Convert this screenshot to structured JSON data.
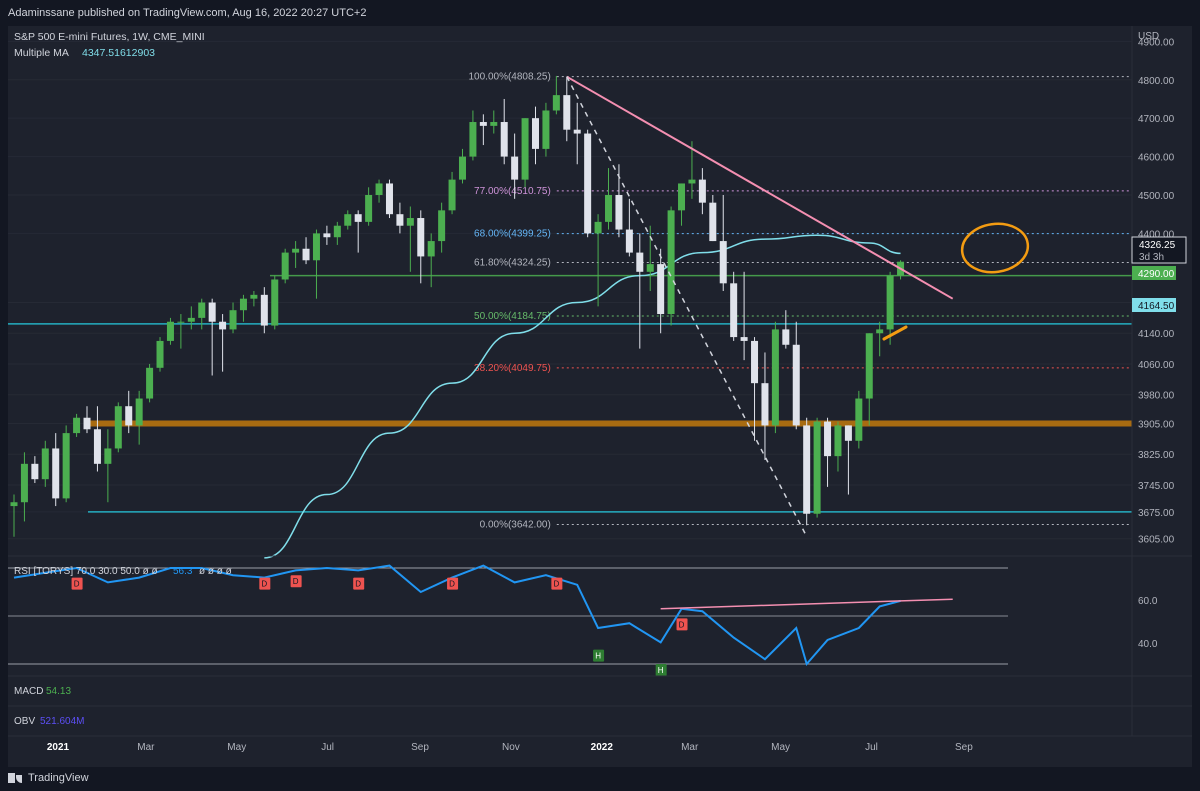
{
  "header": {
    "published_text": "Adaminssane published on TradingView.com, Aug 16, 2022 20:27 UTC+2"
  },
  "legend": {
    "symbol_line": "S&P 500 E-mini Futures, 1W, CME_MINI",
    "ma_label": "Multiple MA",
    "ma_value": "4347.51612903"
  },
  "price_axis": {
    "currency": "USD",
    "ticks": [
      "4900.00",
      "4800.00",
      "4700.00",
      "4600.00",
      "4500.00",
      "4400.00",
      "4220.00",
      "4140.00",
      "4060.00",
      "3980.00",
      "3905.00",
      "3825.00",
      "3745.00",
      "3675.00",
      "3605.00"
    ],
    "current_price": "4326.25",
    "countdown": "3d 3h",
    "green_tag": "4290.00",
    "cyan_tag": "4164.50"
  },
  "fib_labels": [
    {
      "text": "100.00%(4808.25)",
      "color": "#b2b5be"
    },
    {
      "text": "77.00%(4510.75)",
      "color": "#ce93d8"
    },
    {
      "text": "68.00%(4399.25)",
      "color": "#64b5f6"
    },
    {
      "text": "61.80%(4324.25)",
      "color": "#b2b5be"
    },
    {
      "text": "50.00%(4184.75)",
      "color": "#66bb6a"
    },
    {
      "text": "38.20%(4049.75)",
      "color": "#ef5350"
    },
    {
      "text": "0.00%(3642.00)",
      "color": "#b2b5be"
    }
  ],
  "rsi_panel": {
    "legend": "RSI [TORYS]  70.0  30.0  50.0  ø  ø",
    "value": "56.3",
    "tail_symbols": "ø  ø  ø  ø",
    "ticks": [
      "60.0",
      "40.0"
    ],
    "marker_d": "D",
    "marker_h": "H"
  },
  "macd_panel": {
    "label": "MACD",
    "value": "54.13"
  },
  "obv_panel": {
    "label": "OBV",
    "value": "521.604M"
  },
  "time_axis": [
    "2021",
    "Mar",
    "May",
    "Jul",
    "Sep",
    "Nov",
    "2022",
    "Mar",
    "May",
    "Jul",
    "Sep"
  ],
  "footer": {
    "brand": "TradingView"
  },
  "colors": {
    "background": "#1e222d",
    "up": "#4caf50",
    "down": "#e0e3eb",
    "ma": "#80deea",
    "trendline": "#f48fb1",
    "support": "#b7740f",
    "circle": "#f39c12",
    "rsi": "#2196f3"
  },
  "chart_data": {
    "type": "candlestick",
    "title": "S&P 500 E-mini Futures, 1W, CME_MINI",
    "interval": "1W",
    "y_range": [
      3560,
      4940
    ],
    "x_start": "2020-12-28",
    "candles": [
      [
        "2020-12-28",
        3690,
        3720,
        3610,
        3700
      ],
      [
        "2021-01-04",
        3700,
        3830,
        3650,
        3800
      ],
      [
        "2021-01-11",
        3800,
        3820,
        3750,
        3760
      ],
      [
        "2021-01-18",
        3760,
        3860,
        3740,
        3840
      ],
      [
        "2021-01-25",
        3840,
        3880,
        3690,
        3710
      ],
      [
        "2021-02-01",
        3710,
        3900,
        3700,
        3880
      ],
      [
        "2021-02-08",
        3880,
        3930,
        3870,
        3920
      ],
      [
        "2021-02-15",
        3920,
        3950,
        3880,
        3890
      ],
      [
        "2021-02-22",
        3890,
        3950,
        3780,
        3800
      ],
      [
        "2021-03-01",
        3800,
        3890,
        3700,
        3840
      ],
      [
        "2021-03-08",
        3840,
        3960,
        3830,
        3950
      ],
      [
        "2021-03-15",
        3950,
        3990,
        3880,
        3900
      ],
      [
        "2021-03-22",
        3900,
        3990,
        3850,
        3970
      ],
      [
        "2021-03-29",
        3970,
        4060,
        3960,
        4050
      ],
      [
        "2021-04-05",
        4050,
        4130,
        4040,
        4120
      ],
      [
        "2021-04-12",
        4120,
        4180,
        4110,
        4170
      ],
      [
        "2021-04-19",
        4170,
        4190,
        4100,
        4170
      ],
      [
        "2021-04-26",
        4170,
        4210,
        4150,
        4180
      ],
      [
        "2021-05-03",
        4180,
        4230,
        4150,
        4220
      ],
      [
        "2021-05-10",
        4220,
        4230,
        4030,
        4170
      ],
      [
        "2021-05-17",
        4170,
        4190,
        4040,
        4150
      ],
      [
        "2021-05-24",
        4150,
        4220,
        4140,
        4200
      ],
      [
        "2021-05-31",
        4200,
        4240,
        4170,
        4230
      ],
      [
        "2021-06-07",
        4230,
        4250,
        4210,
        4240
      ],
      [
        "2021-06-14",
        4240,
        4260,
        4140,
        4160
      ],
      [
        "2021-06-21",
        4160,
        4290,
        4150,
        4280
      ],
      [
        "2021-06-28",
        4280,
        4360,
        4270,
        4350
      ],
      [
        "2021-07-05",
        4350,
        4380,
        4310,
        4360
      ],
      [
        "2021-07-12",
        4360,
        4390,
        4320,
        4330
      ],
      [
        "2021-07-19",
        4330,
        4410,
        4230,
        4400
      ],
      [
        "2021-07-26",
        4400,
        4420,
        4370,
        4390
      ],
      [
        "2021-08-02",
        4390,
        4430,
        4370,
        4420
      ],
      [
        "2021-08-09",
        4420,
        4460,
        4410,
        4450
      ],
      [
        "2021-08-16",
        4450,
        4460,
        4350,
        4430
      ],
      [
        "2021-08-23",
        4430,
        4520,
        4420,
        4500
      ],
      [
        "2021-08-30",
        4500,
        4540,
        4480,
        4530
      ],
      [
        "2021-09-06",
        4530,
        4540,
        4440,
        4450
      ],
      [
        "2021-09-13",
        4450,
        4480,
        4400,
        4420
      ],
      [
        "2021-09-20",
        4420,
        4470,
        4300,
        4440
      ],
      [
        "2021-09-27",
        4440,
        4460,
        4270,
        4340
      ],
      [
        "2021-10-04",
        4340,
        4400,
        4260,
        4380
      ],
      [
        "2021-10-11",
        4380,
        4480,
        4350,
        4460
      ],
      [
        "2021-10-18",
        4460,
        4560,
        4450,
        4540
      ],
      [
        "2021-10-25",
        4540,
        4620,
        4530,
        4600
      ],
      [
        "2021-11-01",
        4600,
        4720,
        4590,
        4690
      ],
      [
        "2021-11-08",
        4690,
        4710,
        4630,
        4680
      ],
      [
        "2021-11-15",
        4680,
        4720,
        4660,
        4690
      ],
      [
        "2021-11-22",
        4690,
        4750,
        4580,
        4600
      ],
      [
        "2021-11-29",
        4600,
        4660,
        4490,
        4540
      ],
      [
        "2021-12-06",
        4540,
        4700,
        4520,
        4700
      ],
      [
        "2021-12-13",
        4700,
        4730,
        4580,
        4620
      ],
      [
        "2021-12-20",
        4620,
        4740,
        4600,
        4720
      ],
      [
        "2021-12-27",
        4720,
        4810,
        4710,
        4760
      ],
      [
        "2022-01-03",
        4760,
        4808,
        4640,
        4670
      ],
      [
        "2022-01-10",
        4670,
        4740,
        4580,
        4660
      ],
      [
        "2022-01-17",
        4660,
        4670,
        4390,
        4400
      ],
      [
        "2022-01-24",
        4400,
        4450,
        4210,
        4430
      ],
      [
        "2022-01-31",
        4430,
        4570,
        4410,
        4500
      ],
      [
        "2022-02-07",
        4500,
        4580,
        4390,
        4410
      ],
      [
        "2022-02-14",
        4410,
        4490,
        4340,
        4350
      ],
      [
        "2022-02-21",
        4350,
        4400,
        4100,
        4300
      ],
      [
        "2022-02-28",
        4300,
        4420,
        4250,
        4320
      ],
      [
        "2022-03-07",
        4320,
        4360,
        4140,
        4190
      ],
      [
        "2022-03-14",
        4190,
        4470,
        4160,
        4460
      ],
      [
        "2022-03-21",
        4460,
        4530,
        4420,
        4530
      ],
      [
        "2022-03-28",
        4530,
        4640,
        4490,
        4540
      ],
      [
        "2022-04-04",
        4540,
        4570,
        4450,
        4480
      ],
      [
        "2022-04-11",
        4480,
        4500,
        4380,
        4380
      ],
      [
        "2022-04-18",
        4380,
        4500,
        4250,
        4270
      ],
      [
        "2022-04-25",
        4270,
        4300,
        4120,
        4130
      ],
      [
        "2022-05-02",
        4130,
        4300,
        4070,
        4120
      ],
      [
        "2022-05-09",
        4120,
        4130,
        3860,
        4010
      ],
      [
        "2022-05-16",
        4010,
        4090,
        3810,
        3900
      ],
      [
        "2022-05-23",
        3900,
        4170,
        3880,
        4150
      ],
      [
        "2022-05-30",
        4150,
        4200,
        4100,
        4110
      ],
      [
        "2022-06-06",
        4110,
        4170,
        3890,
        3900
      ],
      [
        "2022-06-13",
        3900,
        3920,
        3640,
        3670
      ],
      [
        "2022-06-20",
        3670,
        3920,
        3660,
        3910
      ],
      [
        "2022-06-27",
        3910,
        3920,
        3740,
        3820
      ],
      [
        "2022-07-04",
        3820,
        3910,
        3780,
        3900
      ],
      [
        "2022-07-11",
        3900,
        3900,
        3720,
        3860
      ],
      [
        "2022-07-18",
        3860,
        3990,
        3840,
        3970
      ],
      [
        "2022-07-25",
        3970,
        4140,
        3900,
        4140
      ],
      [
        "2022-08-01",
        4140,
        4170,
        4080,
        4150
      ],
      [
        "2022-08-08",
        4150,
        4300,
        4110,
        4290
      ],
      [
        "2022-08-15",
        4290,
        4330,
        4280,
        4326.25
      ]
    ],
    "fib_levels": [
      {
        "pct": "100.00%",
        "value": 4808.25
      },
      {
        "pct": "77.00%",
        "value": 4510.75
      },
      {
        "pct": "68.00%",
        "value": 4399.25
      },
      {
        "pct": "61.80%",
        "value": 4324.25
      },
      {
        "pct": "50.00%",
        "value": 4184.75
      },
      {
        "pct": "38.20%",
        "value": 4049.75
      },
      {
        "pct": "0.00%",
        "value": 3642.0
      }
    ],
    "horizontal_levels": [
      {
        "name": "support",
        "value": 3905,
        "color": "#b7740f"
      },
      {
        "name": "lower-cyan",
        "value": 3675,
        "color": "#26c6da"
      },
      {
        "name": "upper-cyan",
        "value": 4164.5,
        "color": "#26c6da"
      },
      {
        "name": "green",
        "value": 4290,
        "color": "#4caf50"
      }
    ],
    "trendline": {
      "from": [
        "2022-01-03",
        4808
      ],
      "to": [
        "2022-09-19",
        4230
      ]
    },
    "fib_diagonal": {
      "from": [
        "2022-01-03",
        4808.25
      ],
      "to": [
        "2022-06-13",
        3642
      ]
    },
    "ma_series": [
      [
        "2021-06-14",
        3555
      ],
      [
        "2021-07-26",
        3720
      ],
      [
        "2021-09-06",
        3880
      ],
      [
        "2021-10-18",
        4010
      ],
      [
        "2021-11-29",
        4140
      ],
      [
        "2022-01-10",
        4220
      ],
      [
        "2022-02-21",
        4290
      ],
      [
        "2022-04-04",
        4350
      ],
      [
        "2022-05-16",
        4385
      ],
      [
        "2022-06-20",
        4395
      ],
      [
        "2022-07-25",
        4375
      ],
      [
        "2022-08-15",
        4348
      ]
    ],
    "rsi": {
      "bounds": [
        70,
        30,
        50
      ],
      "last": 56.3,
      "y_range": [
        25,
        75
      ],
      "series": [
        [
          "2020-12-28",
          66
        ],
        [
          "2021-01-18",
          68
        ],
        [
          "2021-02-08",
          70
        ],
        [
          "2021-03-01",
          64
        ],
        [
          "2021-03-22",
          66
        ],
        [
          "2021-04-12",
          70
        ],
        [
          "2021-05-03",
          70
        ],
        [
          "2021-05-24",
          67
        ],
        [
          "2021-06-14",
          66
        ],
        [
          "2021-07-05",
          69
        ],
        [
          "2021-07-26",
          70
        ],
        [
          "2021-08-16",
          69
        ],
        [
          "2021-09-06",
          71
        ],
        [
          "2021-09-27",
          60
        ],
        [
          "2021-10-18",
          66
        ],
        [
          "2021-11-08",
          71
        ],
        [
          "2021-11-29",
          64
        ],
        [
          "2021-12-20",
          67
        ],
        [
          "2022-01-10",
          63
        ],
        [
          "2022-01-24",
          45
        ],
        [
          "2022-02-14",
          47
        ],
        [
          "2022-03-07",
          39
        ],
        [
          "2022-03-21",
          53
        ],
        [
          "2022-04-04",
          52
        ],
        [
          "2022-04-25",
          41
        ],
        [
          "2022-05-16",
          32
        ],
        [
          "2022-06-06",
          45
        ],
        [
          "2022-06-13",
          30
        ],
        [
          "2022-06-27",
          40
        ],
        [
          "2022-07-18",
          45
        ],
        [
          "2022-08-01",
          54
        ],
        [
          "2022-08-15",
          56.3
        ]
      ]
    }
  }
}
